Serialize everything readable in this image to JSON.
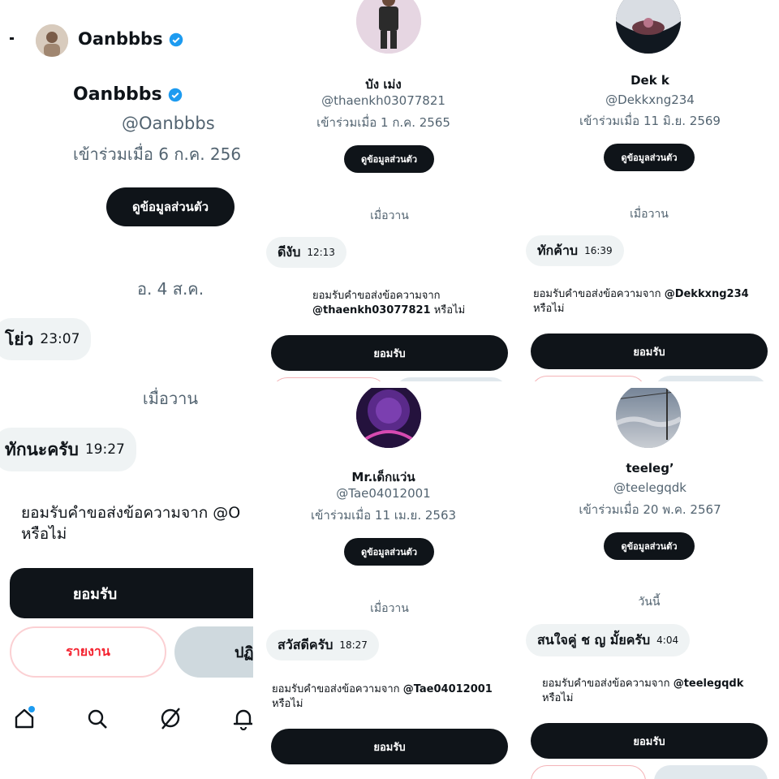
{
  "p1": {
    "top_name": "Oanbbbs",
    "name": "Oanbbbs",
    "handle": "@Oanbbbs",
    "joined": "เข้าร่วมเมื่อ 6 ก.ค. 256",
    "profile_btn": "ดูข้อมูลส่วนตัว",
    "day1": "อ. 4 ส.ค.",
    "msg1": "โย่ว",
    "time1": "23:07",
    "day2": "เมื่อวาน",
    "msg2": "ทักนะครับ",
    "time2": "19:27",
    "req_line1": "ยอมรับคำขอส่งข้อความจาก @O",
    "req_line2": "หรือไม่",
    "accept": "ยอมรับ",
    "report": "รายงาน",
    "decline": "ปฏิ"
  },
  "p2": {
    "name": "บัง เม่ง",
    "handle": "@thaenkh03077821",
    "joined": "เข้าร่วมเมื่อ 1 ก.ค. 2565",
    "profile_btn": "ดูข้อมูลส่วนตัว",
    "day": "เมื่อวาน",
    "msg": "ดีงับ",
    "time": "12:13",
    "req_text": "ยอมรับคำขอส่งข้อความจาก",
    "req_handle": "@thaenkh03077821",
    "req_suffix": "หรือไม่",
    "accept": "ยอมรับ"
  },
  "p3": {
    "name": "Dek k",
    "handle": "@Dekkxng234",
    "joined": "เข้าร่วมเมื่อ 11 มิ.ย. 2569",
    "profile_btn": "ดูข้อมูลส่วนตัว",
    "day": "เมื่อวาน",
    "msg": "ทักค้าบ",
    "time": "16:39",
    "req_text": "ยอมรับคำขอส่งข้อความจาก",
    "req_handle": "@Dekkxng234",
    "req_suffix": "หรือไม่",
    "accept": "ยอมรับ"
  },
  "p4": {
    "name": "Mr.เด็กแว่น",
    "handle": "@Tae04012001",
    "joined": "เข้าร่วมเมื่อ 11 เม.ย. 2563",
    "profile_btn": "ดูข้อมูลส่วนตัว",
    "day": "เมื่อวาน",
    "msg": "สวัสดีครับ",
    "time": "18:27",
    "req_text": "ยอมรับคำขอส่งข้อความจาก",
    "req_handle": "@Tae04012001",
    "req_suffix": "หรือไม่",
    "accept": "ยอมรับ"
  },
  "p5": {
    "name": "teeleg’",
    "handle": "@teelegqdk",
    "joined": "เข้าร่วมเมื่อ 20 พ.ค. 2567",
    "profile_btn": "ดูข้อมูลส่วนตัว",
    "day": "วันนี้",
    "msg": "สนใจคู่ ช ญ มั้ยครับ",
    "time": "4:04",
    "req_text": "ยอมรับคำขอส่งข้อความจาก",
    "req_handle": "@teelegqdk",
    "req_suffix": "หรือไม่",
    "accept": "ยอมรับ"
  },
  "nav_icons": [
    "home-icon",
    "search-icon",
    "grok-icon",
    "bell-icon"
  ],
  "colors": {
    "accent_blue": "#1d9bf0",
    "dark": "#0f1419",
    "muted": "#536471",
    "bubble": "#eff3f4",
    "danger": "#f4212e"
  }
}
